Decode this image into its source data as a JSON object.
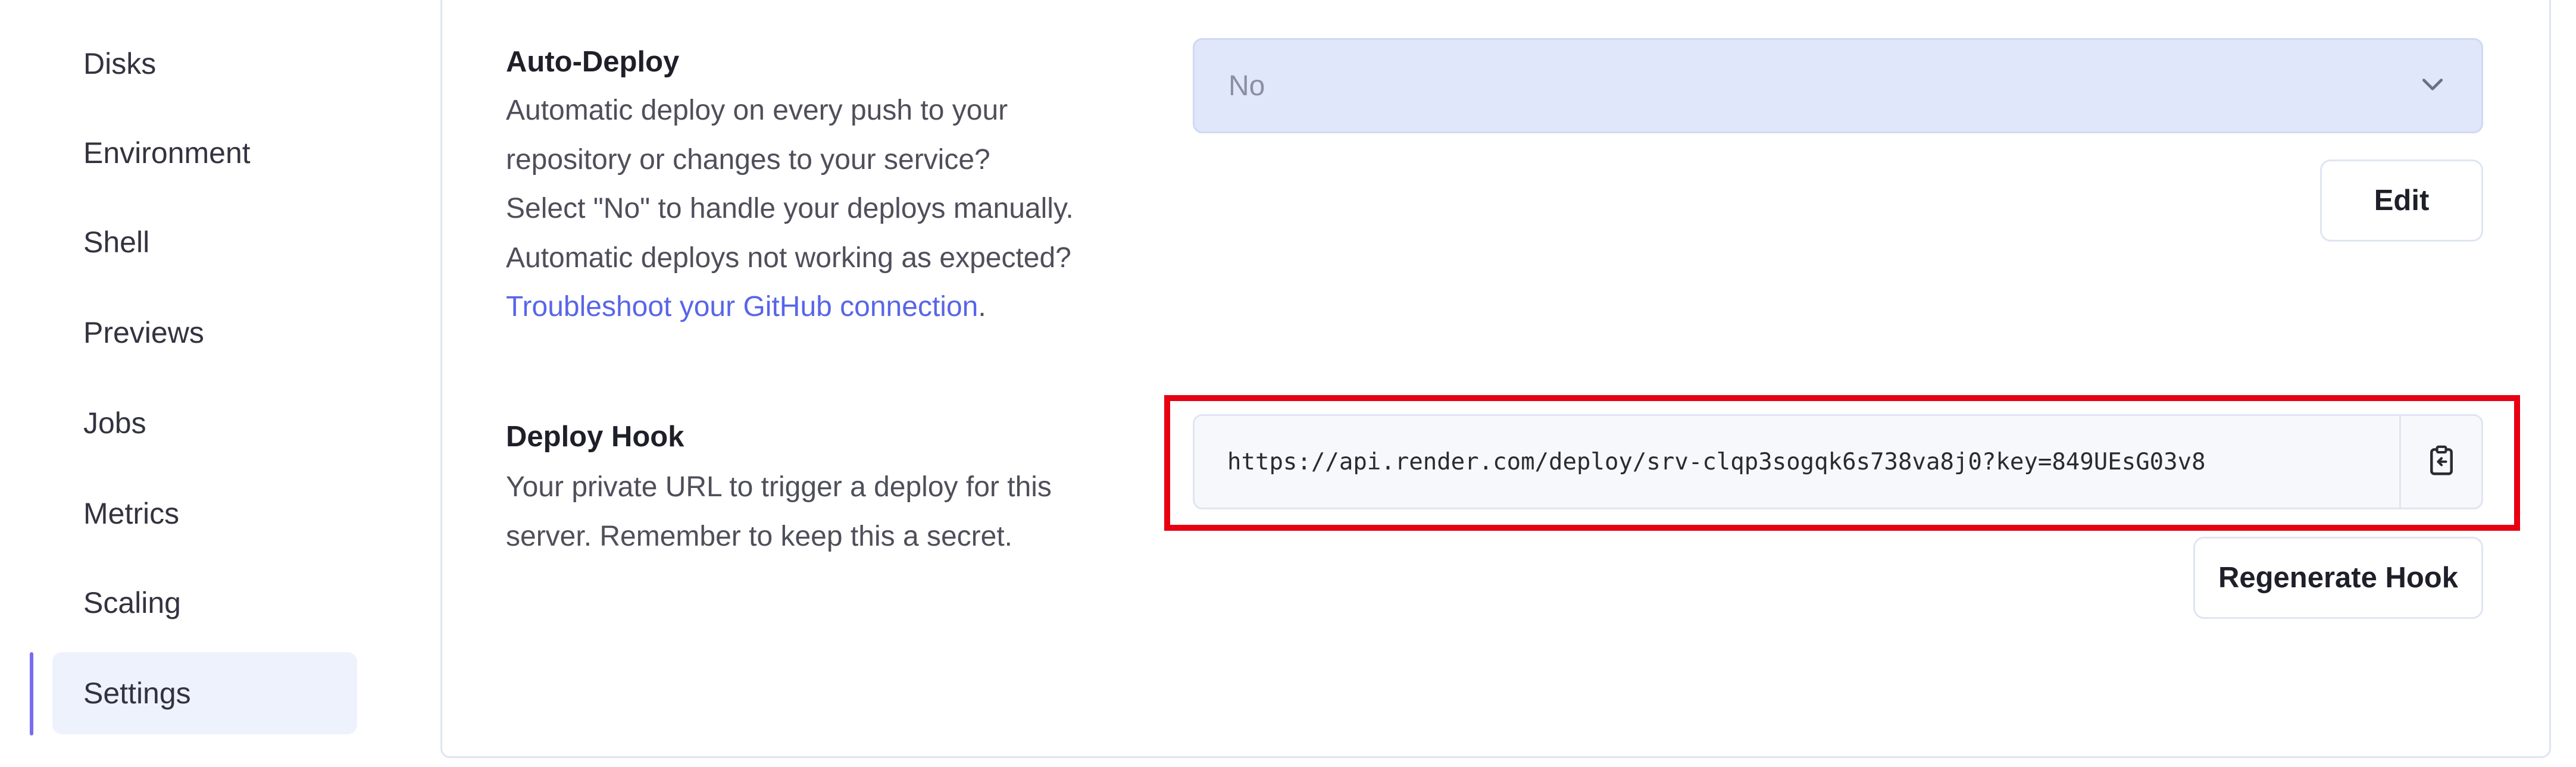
{
  "sidebar": {
    "items": [
      {
        "label": "Disks"
      },
      {
        "label": "Environment"
      },
      {
        "label": "Shell"
      },
      {
        "label": "Previews"
      },
      {
        "label": "Jobs"
      },
      {
        "label": "Metrics"
      },
      {
        "label": "Scaling"
      },
      {
        "label": "Settings",
        "active": true
      }
    ]
  },
  "auto_deploy": {
    "title": "Auto-Deploy",
    "lines": [
      "Automatic deploy on every push to your",
      "repository or changes to your service?",
      "Select \"No\" to handle your deploys manually.",
      "Automatic deploys not working as expected?"
    ],
    "link_text": "Troubleshoot your GitHub connection",
    "link_suffix": ".",
    "select_value": "No",
    "edit_label": "Edit"
  },
  "deploy_hook": {
    "title": "Deploy Hook",
    "lines": [
      "Your private URL to trigger a deploy for this",
      "server. Remember to keep this a secret."
    ],
    "url": "https://api.render.com/deploy/srv-clqp3sogqk6s738va8j0?key=849UEsG03v8",
    "regenerate_label": "Regenerate Hook"
  },
  "icons": {
    "select_chevron": "chevron-down-icon",
    "copy": "clipboard-copy-icon"
  },
  "colors": {
    "accent": "#7a6cf0",
    "link": "#5865e8",
    "highlight": "#e60012",
    "select_bg": "#e0e7fa"
  }
}
